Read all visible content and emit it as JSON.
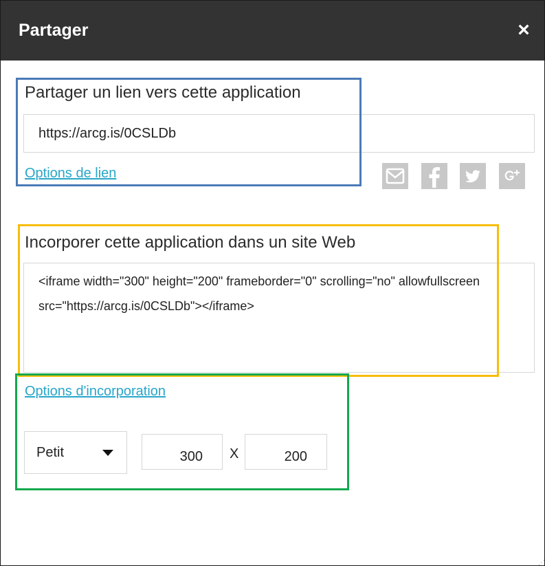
{
  "dialog": {
    "title": "Partager",
    "close_symbol": "×"
  },
  "share_link": {
    "heading": "Partager un lien vers cette application",
    "url": "https://arcg.is/0CSLDb",
    "options_label": "Options de lien",
    "social_icons": [
      "email-icon",
      "facebook-icon",
      "twitter-icon",
      "google-plus-icon"
    ]
  },
  "embed": {
    "heading": "Incorporer cette application dans un site Web",
    "code": "<iframe width=\"300\" height=\"200\" frameborder=\"0\" scrolling=\"no\" allowfullscreen src=\"https://arcg.is/0CSLDb\"></iframe>",
    "options_label": "Options d'incorporation",
    "size_selected": "Petit",
    "width": "300",
    "separator": "X",
    "height": "200"
  },
  "colors": {
    "titlebar": "#333333",
    "link": "#27a6c9",
    "social_icon_bg": "#c8c8c8",
    "highlight_link_section": "#4a7ab7",
    "highlight_embed_section": "#f7bd0a",
    "highlight_embed_options": "#12a84d"
  }
}
